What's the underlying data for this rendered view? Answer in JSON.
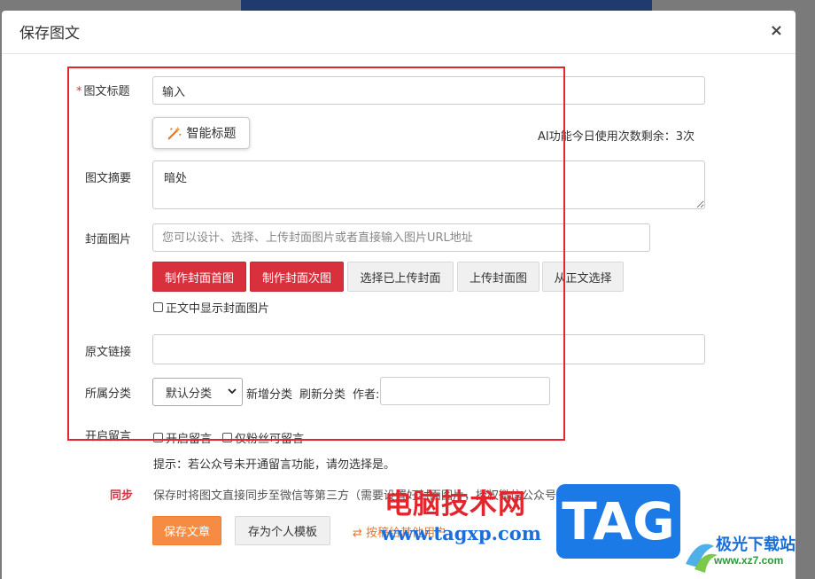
{
  "modal": {
    "title": "保存图文",
    "close_symbol": "×"
  },
  "form": {
    "title_label": "图文标题",
    "required_mark": "*",
    "title_value": "输入",
    "ai_title_button": "智能标题",
    "ai_quota": "AI功能今日使用次数剩余：3次",
    "summary_label": "图文摘要",
    "summary_value": "暗处",
    "cover_label": "封面图片",
    "cover_placeholder": "您可以设计、选择、上传封面图片或者直接输入图片URL地址",
    "cover_buttons": [
      "制作封面首图",
      "制作封面次图",
      "选择已上传封面",
      "上传封面图",
      "从正文选择"
    ],
    "show_cover_in_body": "正文中显示封面图片",
    "source_link_label": "原文链接",
    "source_link_value": "",
    "category_label": "所属分类",
    "category_selected": "默认分类",
    "add_category": "新增分类",
    "refresh_category": "刷新分类",
    "author_label": "作者:",
    "author_value": "",
    "comments_label": "开启留言",
    "enable_comments": "开启留言",
    "followers_only": "仅粉丝可留言",
    "comments_tip": "提示：若公众号未开通留言功能，请勿选择是。",
    "sync_label": "同步",
    "sync_text": "保存时将图文直接同步至微信等第三方（需要设置好封面图片，授权微信公众号）",
    "save_button": "保存文章",
    "template_button": "存为个人模板",
    "transfer_button": "⇄ 按稿给其他用户"
  },
  "watermark": {
    "text": "电脑技术网",
    "url": "www.tagxp.com",
    "tag": "TAG",
    "site_name": "极光下载站",
    "site_url": "www.xz7.com"
  },
  "colors": {
    "accent_red": "#d9303e",
    "accent_orange": "#f68b43",
    "highlight": "#e3262e"
  }
}
